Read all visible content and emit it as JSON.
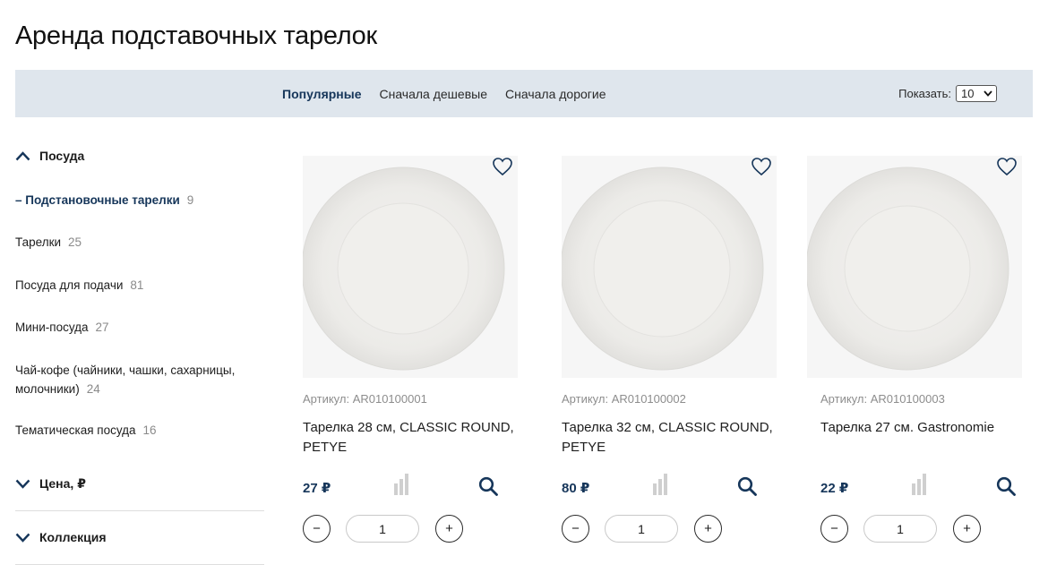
{
  "page": {
    "title": "Аренда подставочных тарелок"
  },
  "sort": {
    "options": [
      {
        "label": "Популярные",
        "active": true
      },
      {
        "label": "Сначала дешевые",
        "active": false
      },
      {
        "label": "Сначала дорогие",
        "active": false
      }
    ],
    "show_label": "Показать:",
    "show_value": "10"
  },
  "sidebar": {
    "category": "Посуда",
    "items": [
      {
        "prefix": "–",
        "label": "Подстановочные тарелки",
        "count": "9",
        "active": true
      },
      {
        "label": "Тарелки",
        "count": "25"
      },
      {
        "label": "Посуда для подачи",
        "count": "81"
      },
      {
        "label": "Мини-посуда",
        "count": "27"
      },
      {
        "label": "Чай-кофе (чайники, чашки, сахарницы, молочники)",
        "count": "24"
      },
      {
        "label": "Тематическая посуда",
        "count": "16"
      }
    ],
    "filters": [
      {
        "label": "Цена, ₽"
      },
      {
        "label": "Коллекция"
      }
    ]
  },
  "products": [
    {
      "sku": "Артикул: AR010100001",
      "name": "Тарелка 28 см, CLASSIC ROUND, PETYE",
      "price": "27 ₽",
      "qty": "1",
      "minus": "−",
      "plus": "+"
    },
    {
      "sku": "Артикул: AR010100002",
      "name": "Тарелка 32 см, CLASSIC ROUND, PETYE",
      "price": "80 ₽",
      "qty": "1",
      "minus": "−",
      "plus": "+"
    },
    {
      "sku": "Артикул: AR010100003",
      "name": "Тарелка 27 см. Gastronomie",
      "price": "22 ₽",
      "qty": "1",
      "minus": "−",
      "plus": "+"
    }
  ],
  "icons": {
    "heart": "heart-icon",
    "compare": "compare-bars-icon",
    "zoom": "search-icon",
    "chevron_up": "chevron-up-icon",
    "chevron_down": "chevron-down-icon"
  },
  "colors": {
    "accent": "#16365a",
    "sortbar_bg": "#dfe6ed",
    "muted": "#8a8a8a"
  }
}
